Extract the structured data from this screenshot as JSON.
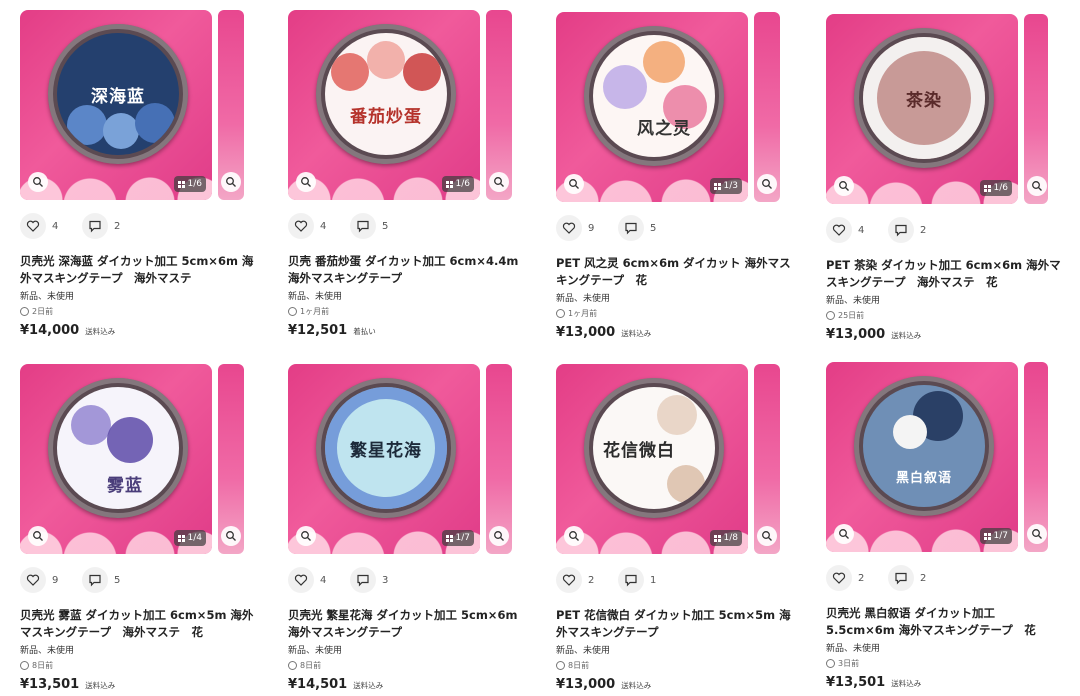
{
  "products": [
    {
      "tape_text": "深海蓝",
      "page": "1/6",
      "likes": "4",
      "comments": "2",
      "title": "贝壳光 深海蓝 ダイカット加工 5cm×6m 海外マスキングテープ　海外マステ",
      "condition": "新品、未使用",
      "posted": "2日前",
      "price": "¥14,000",
      "shipping": "送料込み",
      "colors": {
        "face": "#24406e",
        "text": "#ffffff",
        "flower": "#5b86c8"
      }
    },
    {
      "tape_text": "番茄炒蛋",
      "page": "1/6",
      "likes": "4",
      "comments": "5",
      "title": "贝壳 番茄炒蛋 ダイカット加工 6cm×4.4m 海外マスキングテープ",
      "condition": "新品、未使用",
      "posted": "1ヶ月前",
      "price": "¥12,501",
      "shipping": "着払い",
      "colors": {
        "face": "#fbf3f3",
        "text": "#b5322b",
        "flower": "#e0605a"
      }
    },
    {
      "tape_text": "风之灵",
      "page": "1/3",
      "likes": "9",
      "comments": "5",
      "title": "PET 风之灵 6cm×6m ダイカット 海外マスキングテープ　花",
      "condition": "新品、未使用",
      "posted": "1ヶ月前",
      "price": "¥13,000",
      "shipping": "送料込み",
      "colors": {
        "face": "#fdf6f4",
        "text": "#333333",
        "flower": "#f2a36b"
      }
    },
    {
      "tape_text": "茶染",
      "page": "1/6",
      "likes": "4",
      "comments": "2",
      "title": "PET 茶染 ダイカット加工 6cm×6m 海外マスキングテープ　海外マステ　花",
      "condition": "新品、未使用",
      "posted": "25日前",
      "price": "¥13,000",
      "shipping": "送料込み",
      "colors": {
        "face": "#c89a97",
        "text": "#5a2a2a",
        "flower": "#f3f0ef"
      }
    },
    {
      "tape_text": "雾蓝",
      "page": "1/4",
      "likes": "9",
      "comments": "5",
      "title": "贝壳光 雾蓝 ダイカット加工 6cm×5m 海外マスキングテープ　海外マステ　花",
      "condition": "新品、未使用",
      "posted": "8日前",
      "price": "¥13,501",
      "shipping": "送料込み",
      "colors": {
        "face": "#f6f4fb",
        "text": "#4a3d7a",
        "flower": "#5d4aa8"
      }
    },
    {
      "tape_text": "繁星花海",
      "page": "1/7",
      "likes": "4",
      "comments": "3",
      "title": "贝壳光 繁星花海 ダイカット加工 5cm×6m 海外マスキングテープ",
      "condition": "新品、未使用",
      "posted": "8日前",
      "price": "¥14,501",
      "shipping": "送料込み",
      "colors": {
        "face": "#bfe4ef",
        "text": "#1d2a3a",
        "flower": "#3a63c9"
      }
    },
    {
      "tape_text": "花信微白",
      "page": "1/8",
      "likes": "2",
      "comments": "1",
      "title": "PET 花信微白 ダイカット加工 5cm×5m 海外マスキングテープ",
      "condition": "新品、未使用",
      "posted": "8日前",
      "price": "¥13,000",
      "shipping": "送料込み",
      "colors": {
        "face": "#fbf8f6",
        "text": "#2b2b2b",
        "flower": "#b07a55"
      }
    },
    {
      "tape_text": "黑白叙语",
      "page": "1/7",
      "likes": "2",
      "comments": "2",
      "title": "贝壳光 黑白叙语 ダイカット加工 5.5cm×6m 海外マスキングテープ　花",
      "condition": "新品、未使用",
      "posted": "3日前",
      "price": "¥13,501",
      "shipping": "送料込み",
      "colors": {
        "face": "#6f8fb6",
        "text": "#ffffff",
        "flower": "#1f3358"
      }
    }
  ]
}
